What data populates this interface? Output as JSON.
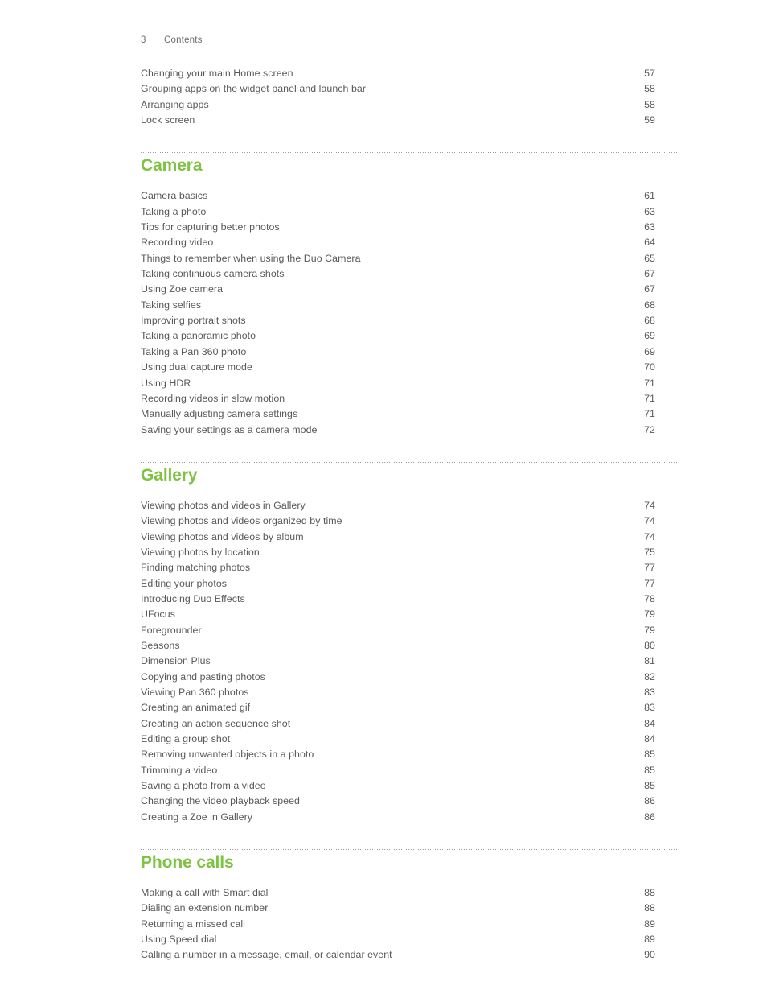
{
  "header": {
    "folio": "3",
    "label": "Contents"
  },
  "colors": {
    "heading_green": "#7ec342",
    "body_text": "#58595b",
    "rule": "#9b9b9b"
  },
  "sections": [
    {
      "heading": null,
      "entries": [
        {
          "title": "Changing your main Home screen",
          "page": "57"
        },
        {
          "title": "Grouping apps on the widget panel and launch bar",
          "page": "58"
        },
        {
          "title": "Arranging apps",
          "page": "58"
        },
        {
          "title": "Lock screen",
          "page": "59"
        }
      ]
    },
    {
      "heading": "Camera",
      "entries": [
        {
          "title": "Camera basics",
          "page": "61"
        },
        {
          "title": "Taking a photo",
          "page": "63"
        },
        {
          "title": "Tips for capturing better photos",
          "page": "63"
        },
        {
          "title": "Recording video",
          "page": "64"
        },
        {
          "title": "Things to remember when using the Duo Camera",
          "page": "65"
        },
        {
          "title": "Taking continuous camera shots",
          "page": "67"
        },
        {
          "title": "Using Zoe camera",
          "page": "67"
        },
        {
          "title": "Taking selfies",
          "page": "68"
        },
        {
          "title": "Improving portrait shots",
          "page": "68"
        },
        {
          "title": "Taking a panoramic photo",
          "page": "69"
        },
        {
          "title": "Taking a Pan 360 photo",
          "page": "69"
        },
        {
          "title": "Using dual capture mode",
          "page": "70"
        },
        {
          "title": "Using HDR",
          "page": "71"
        },
        {
          "title": "Recording videos in slow motion",
          "page": "71"
        },
        {
          "title": "Manually adjusting camera settings",
          "page": "71"
        },
        {
          "title": "Saving your settings as a camera mode",
          "page": "72"
        }
      ]
    },
    {
      "heading": "Gallery",
      "entries": [
        {
          "title": "Viewing photos and videos in Gallery",
          "page": "74"
        },
        {
          "title": "Viewing photos and videos organized by time",
          "page": "74"
        },
        {
          "title": "Viewing photos and videos by album",
          "page": "74"
        },
        {
          "title": "Viewing photos by location",
          "page": "75"
        },
        {
          "title": "Finding matching photos",
          "page": "77"
        },
        {
          "title": "Editing your photos",
          "page": "77"
        },
        {
          "title": "Introducing Duo Effects",
          "page": "78"
        },
        {
          "title": "UFocus",
          "page": "79"
        },
        {
          "title": "Foregrounder",
          "page": "79"
        },
        {
          "title": "Seasons",
          "page": "80"
        },
        {
          "title": "Dimension Plus",
          "page": "81"
        },
        {
          "title": "Copying and pasting photos",
          "page": "82"
        },
        {
          "title": "Viewing Pan 360 photos",
          "page": "83"
        },
        {
          "title": "Creating an animated gif",
          "page": "83"
        },
        {
          "title": "Creating an action sequence shot",
          "page": "84"
        },
        {
          "title": "Editing a group shot",
          "page": "84"
        },
        {
          "title": "Removing unwanted objects in a photo",
          "page": "85"
        },
        {
          "title": "Trimming a video",
          "page": "85"
        },
        {
          "title": "Saving a photo from a video",
          "page": "85"
        },
        {
          "title": "Changing the video playback speed",
          "page": "86"
        },
        {
          "title": "Creating a Zoe in Gallery",
          "page": "86"
        }
      ]
    },
    {
      "heading": "Phone calls",
      "entries": [
        {
          "title": "Making a call with Smart dial",
          "page": "88"
        },
        {
          "title": "Dialing an extension number",
          "page": "88"
        },
        {
          "title": "Returning a missed call",
          "page": "89"
        },
        {
          "title": "Using Speed dial",
          "page": "89"
        },
        {
          "title": "Calling a number in a message, email, or calendar event",
          "page": "90"
        }
      ]
    }
  ]
}
